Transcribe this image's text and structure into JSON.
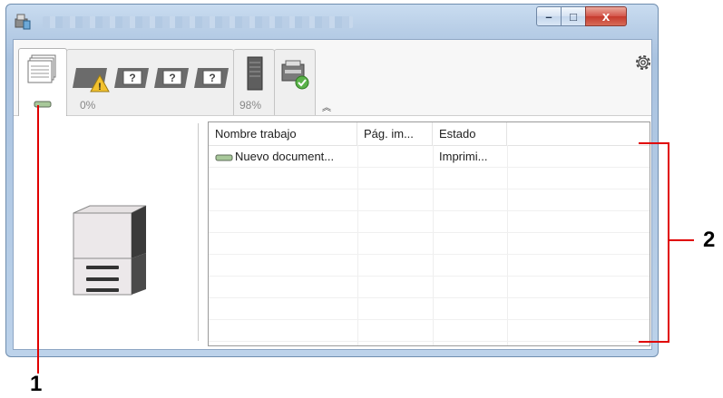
{
  "window": {
    "title": "",
    "controls": {
      "minimize": "–",
      "maximize": "□",
      "close": "x"
    }
  },
  "toolbar": {
    "toner_percent": "0%",
    "paper_percent": "98%",
    "settings_icon": "gear-icon",
    "collapse_icon": "chevron-up-icon"
  },
  "job_list": {
    "columns": [
      "Nombre trabajo",
      "Pág. im...",
      "Estado"
    ],
    "rows": [
      {
        "name": "Nuevo document...",
        "pages": "",
        "status": "Imprimi..."
      }
    ]
  },
  "callouts": {
    "one": "1",
    "two": "2"
  },
  "colors": {
    "title_bar": "#b7cde6",
    "callout_line": "#e00000",
    "list_border": "#9a9a9a"
  }
}
